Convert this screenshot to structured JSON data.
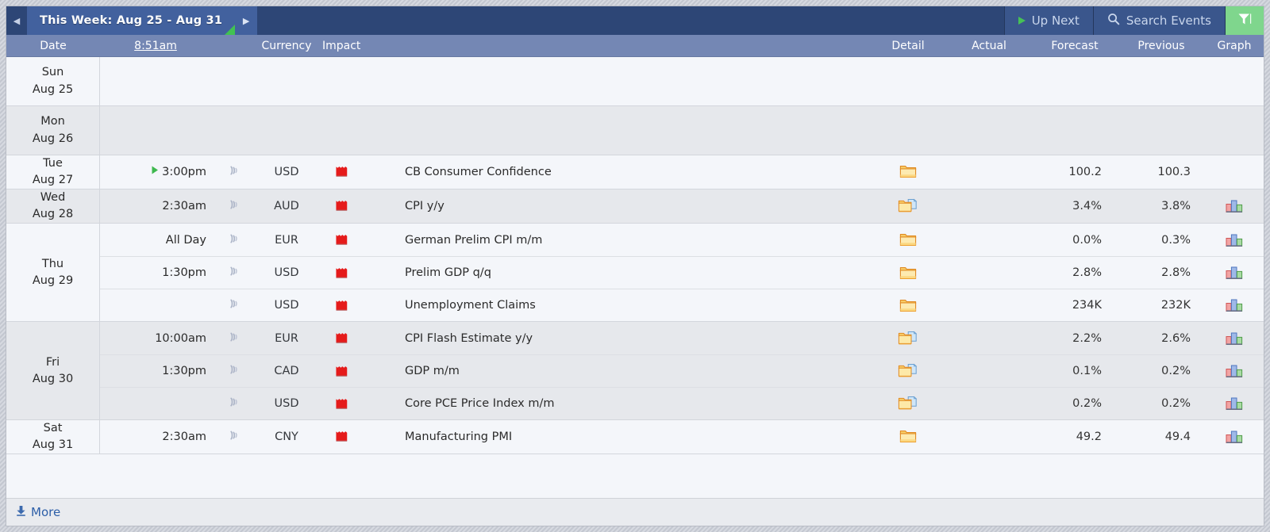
{
  "topbar": {
    "prev_arrow": "◀",
    "next_arrow": "▶",
    "week_title": "This Week: Aug 25 - Aug 31",
    "up_next_label": "Up Next",
    "search_label": "Search Events",
    "filter_icon": "funnel-icon",
    "colors": {
      "navy": "#2d4676",
      "tab_blue": "#42619e",
      "accent_green": "#41c252",
      "filter_green": "#7fd68d",
      "header_slate": "#7487b4"
    }
  },
  "columns": {
    "date": "Date",
    "time": "8:51am",
    "currency": "Currency",
    "impact": "Impact",
    "detail": "Detail",
    "actual": "Actual",
    "forecast": "Forecast",
    "previous": "Previous",
    "graph": "Graph"
  },
  "days": [
    {
      "weekday": "Sun",
      "date": "Aug 25",
      "shade": "odd",
      "events": []
    },
    {
      "weekday": "Mon",
      "date": "Aug 26",
      "shade": "even",
      "events": []
    },
    {
      "weekday": "Tue",
      "date": "Aug 27",
      "shade": "odd",
      "events": [
        {
          "time": "3:00pm",
          "upcoming": true,
          "sound": "speaker-icon",
          "currency": "USD",
          "impact": "high",
          "title": "CB Consumer Confidence",
          "detail": "folder",
          "actual": "",
          "forecast": "100.2",
          "previous": "100.3",
          "graph": false
        }
      ]
    },
    {
      "weekday": "Wed",
      "date": "Aug 28",
      "shade": "even",
      "events": [
        {
          "time": "2:30am",
          "upcoming": false,
          "sound": "speaker-icon",
          "currency": "AUD",
          "impact": "high",
          "title": "CPI y/y",
          "detail": "folder-doc",
          "actual": "",
          "forecast": "3.4%",
          "previous": "3.8%",
          "graph": true
        }
      ]
    },
    {
      "weekday": "Thu",
      "date": "Aug 29",
      "shade": "odd",
      "events": [
        {
          "time": "All Day",
          "upcoming": false,
          "sound": "speaker-icon",
          "currency": "EUR",
          "impact": "high",
          "title": "German Prelim CPI m/m",
          "detail": "folder",
          "actual": "",
          "forecast": "0.0%",
          "previous": "0.3%",
          "graph": true
        },
        {
          "time": "1:30pm",
          "upcoming": false,
          "sound": "speaker-icon",
          "currency": "USD",
          "impact": "high",
          "title": "Prelim GDP q/q",
          "detail": "folder",
          "actual": "",
          "forecast": "2.8%",
          "previous": "2.8%",
          "graph": true
        },
        {
          "time": "",
          "upcoming": false,
          "sound": "speaker-icon",
          "currency": "USD",
          "impact": "high",
          "title": "Unemployment Claims",
          "detail": "folder",
          "actual": "",
          "forecast": "234K",
          "previous": "232K",
          "graph": true
        }
      ]
    },
    {
      "weekday": "Fri",
      "date": "Aug 30",
      "shade": "even",
      "events": [
        {
          "time": "10:00am",
          "upcoming": false,
          "sound": "speaker-icon",
          "currency": "EUR",
          "impact": "high",
          "title": "CPI Flash Estimate y/y",
          "detail": "folder-doc",
          "actual": "",
          "forecast": "2.2%",
          "previous": "2.6%",
          "graph": true
        },
        {
          "time": "1:30pm",
          "upcoming": false,
          "sound": "speaker-icon",
          "currency": "CAD",
          "impact": "high",
          "title": "GDP m/m",
          "detail": "folder-doc",
          "actual": "",
          "forecast": "0.1%",
          "previous": "0.2%",
          "graph": true
        },
        {
          "time": "",
          "upcoming": false,
          "sound": "speaker-icon",
          "currency": "USD",
          "impact": "high",
          "title": "Core PCE Price Index m/m",
          "detail": "folder-doc",
          "actual": "",
          "forecast": "0.2%",
          "previous": "0.2%",
          "graph": true
        }
      ]
    },
    {
      "weekday": "Sat",
      "date": "Aug 31",
      "shade": "odd",
      "events": [
        {
          "time": "2:30am",
          "upcoming": false,
          "sound": "speaker-icon",
          "currency": "CNY",
          "impact": "high",
          "title": "Manufacturing PMI",
          "detail": "folder",
          "actual": "",
          "forecast": "49.2",
          "previous": "49.4",
          "graph": true
        }
      ]
    }
  ],
  "footer": {
    "more_label": "More",
    "more_icon": "download-icon"
  }
}
